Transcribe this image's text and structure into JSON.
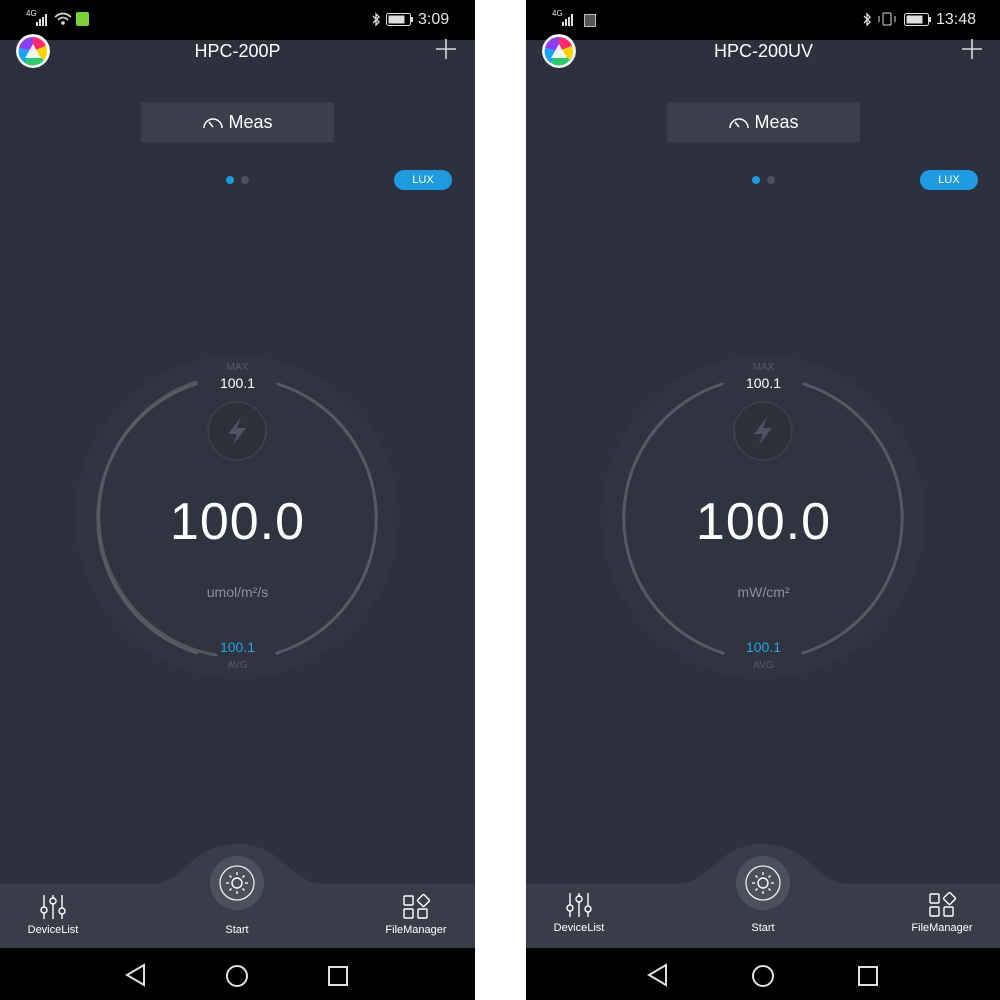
{
  "screens": [
    {
      "status": {
        "time": "3:09",
        "network": "4G"
      },
      "title": "HPC-200P",
      "tab_label": "Meas",
      "lux_label": "LUX",
      "gauge": {
        "max_label": "MAX",
        "max_value": "100.1",
        "value": "100.0",
        "unit": "umol/m²/s",
        "avg_value": "100.1",
        "avg_label": "AVG"
      },
      "nav": {
        "devicelist": "DeviceList",
        "start": "Start",
        "filemanager": "FileManager"
      }
    },
    {
      "status": {
        "time": "13:48",
        "network": "4G"
      },
      "title": "HPC-200UV",
      "tab_label": "Meas",
      "lux_label": "LUX",
      "gauge": {
        "max_label": "MAX",
        "max_value": "100.1",
        "value": "100.0",
        "unit": "mW/cm²",
        "avg_value": "100.1",
        "avg_label": "AVG"
      },
      "nav": {
        "devicelist": "DeviceList",
        "start": "Start",
        "filemanager": "FileManager"
      }
    }
  ],
  "colors": {
    "background": "#2c313d",
    "accent": "#1e9be0",
    "avg_value": "#24a3e6",
    "bottom_bar": "#383d49"
  },
  "icons": [
    "logo-icon",
    "plus-icon",
    "gauge-icon",
    "bolt-icon",
    "sun-icon",
    "sliders-icon",
    "grid-icon",
    "back-icon",
    "home-icon",
    "recents-icon",
    "bluetooth-icon",
    "battery-icon",
    "wifi-icon",
    "signal-icon",
    "vibrate-icon"
  ]
}
